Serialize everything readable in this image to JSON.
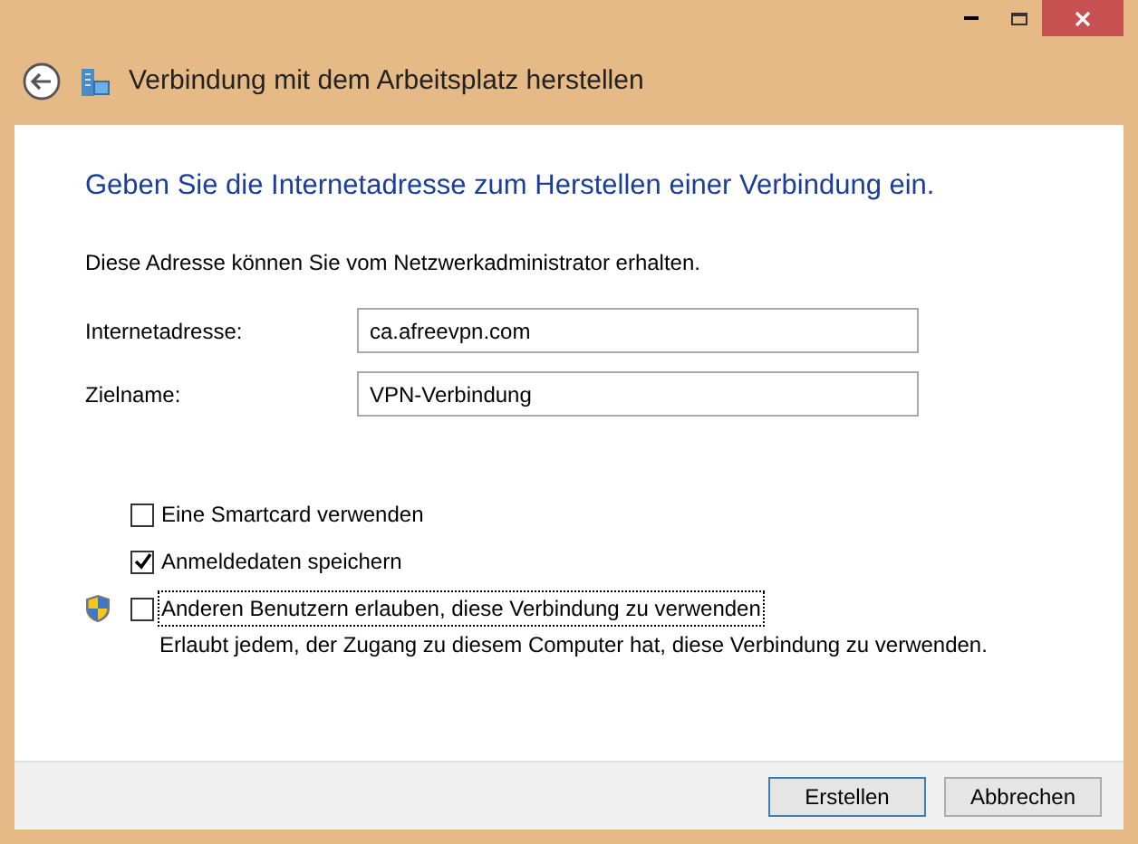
{
  "window": {
    "title": "Verbindung mit dem Arbeitsplatz herstellen"
  },
  "heading": "Geben Sie die Internetadresse zum Herstellen einer Verbindung ein.",
  "description": "Diese Adresse können Sie vom Netzwerkadministrator erhalten.",
  "fields": [
    {
      "label": "Internetadresse:",
      "value": "ca.afreevpn.com"
    },
    {
      "label": "Zielname:",
      "value": "VPN-Verbindung"
    }
  ],
  "options": [
    {
      "label": "Eine Smartcard verwenden",
      "checked": false,
      "shield": false,
      "focused": false
    },
    {
      "label": "Anmeldedaten speichern",
      "checked": true,
      "shield": false,
      "focused": false
    },
    {
      "label": "Anderen Benutzern erlauben, diese Verbindung zu verwenden",
      "checked": false,
      "shield": true,
      "focused": true,
      "note": "Erlaubt jedem, der Zugang zu diesem Computer hat, diese Verbindung zu verwenden."
    }
  ],
  "buttons": [
    {
      "label": "Erstellen",
      "default": true
    },
    {
      "label": "Abbrechen",
      "default": false
    }
  ]
}
